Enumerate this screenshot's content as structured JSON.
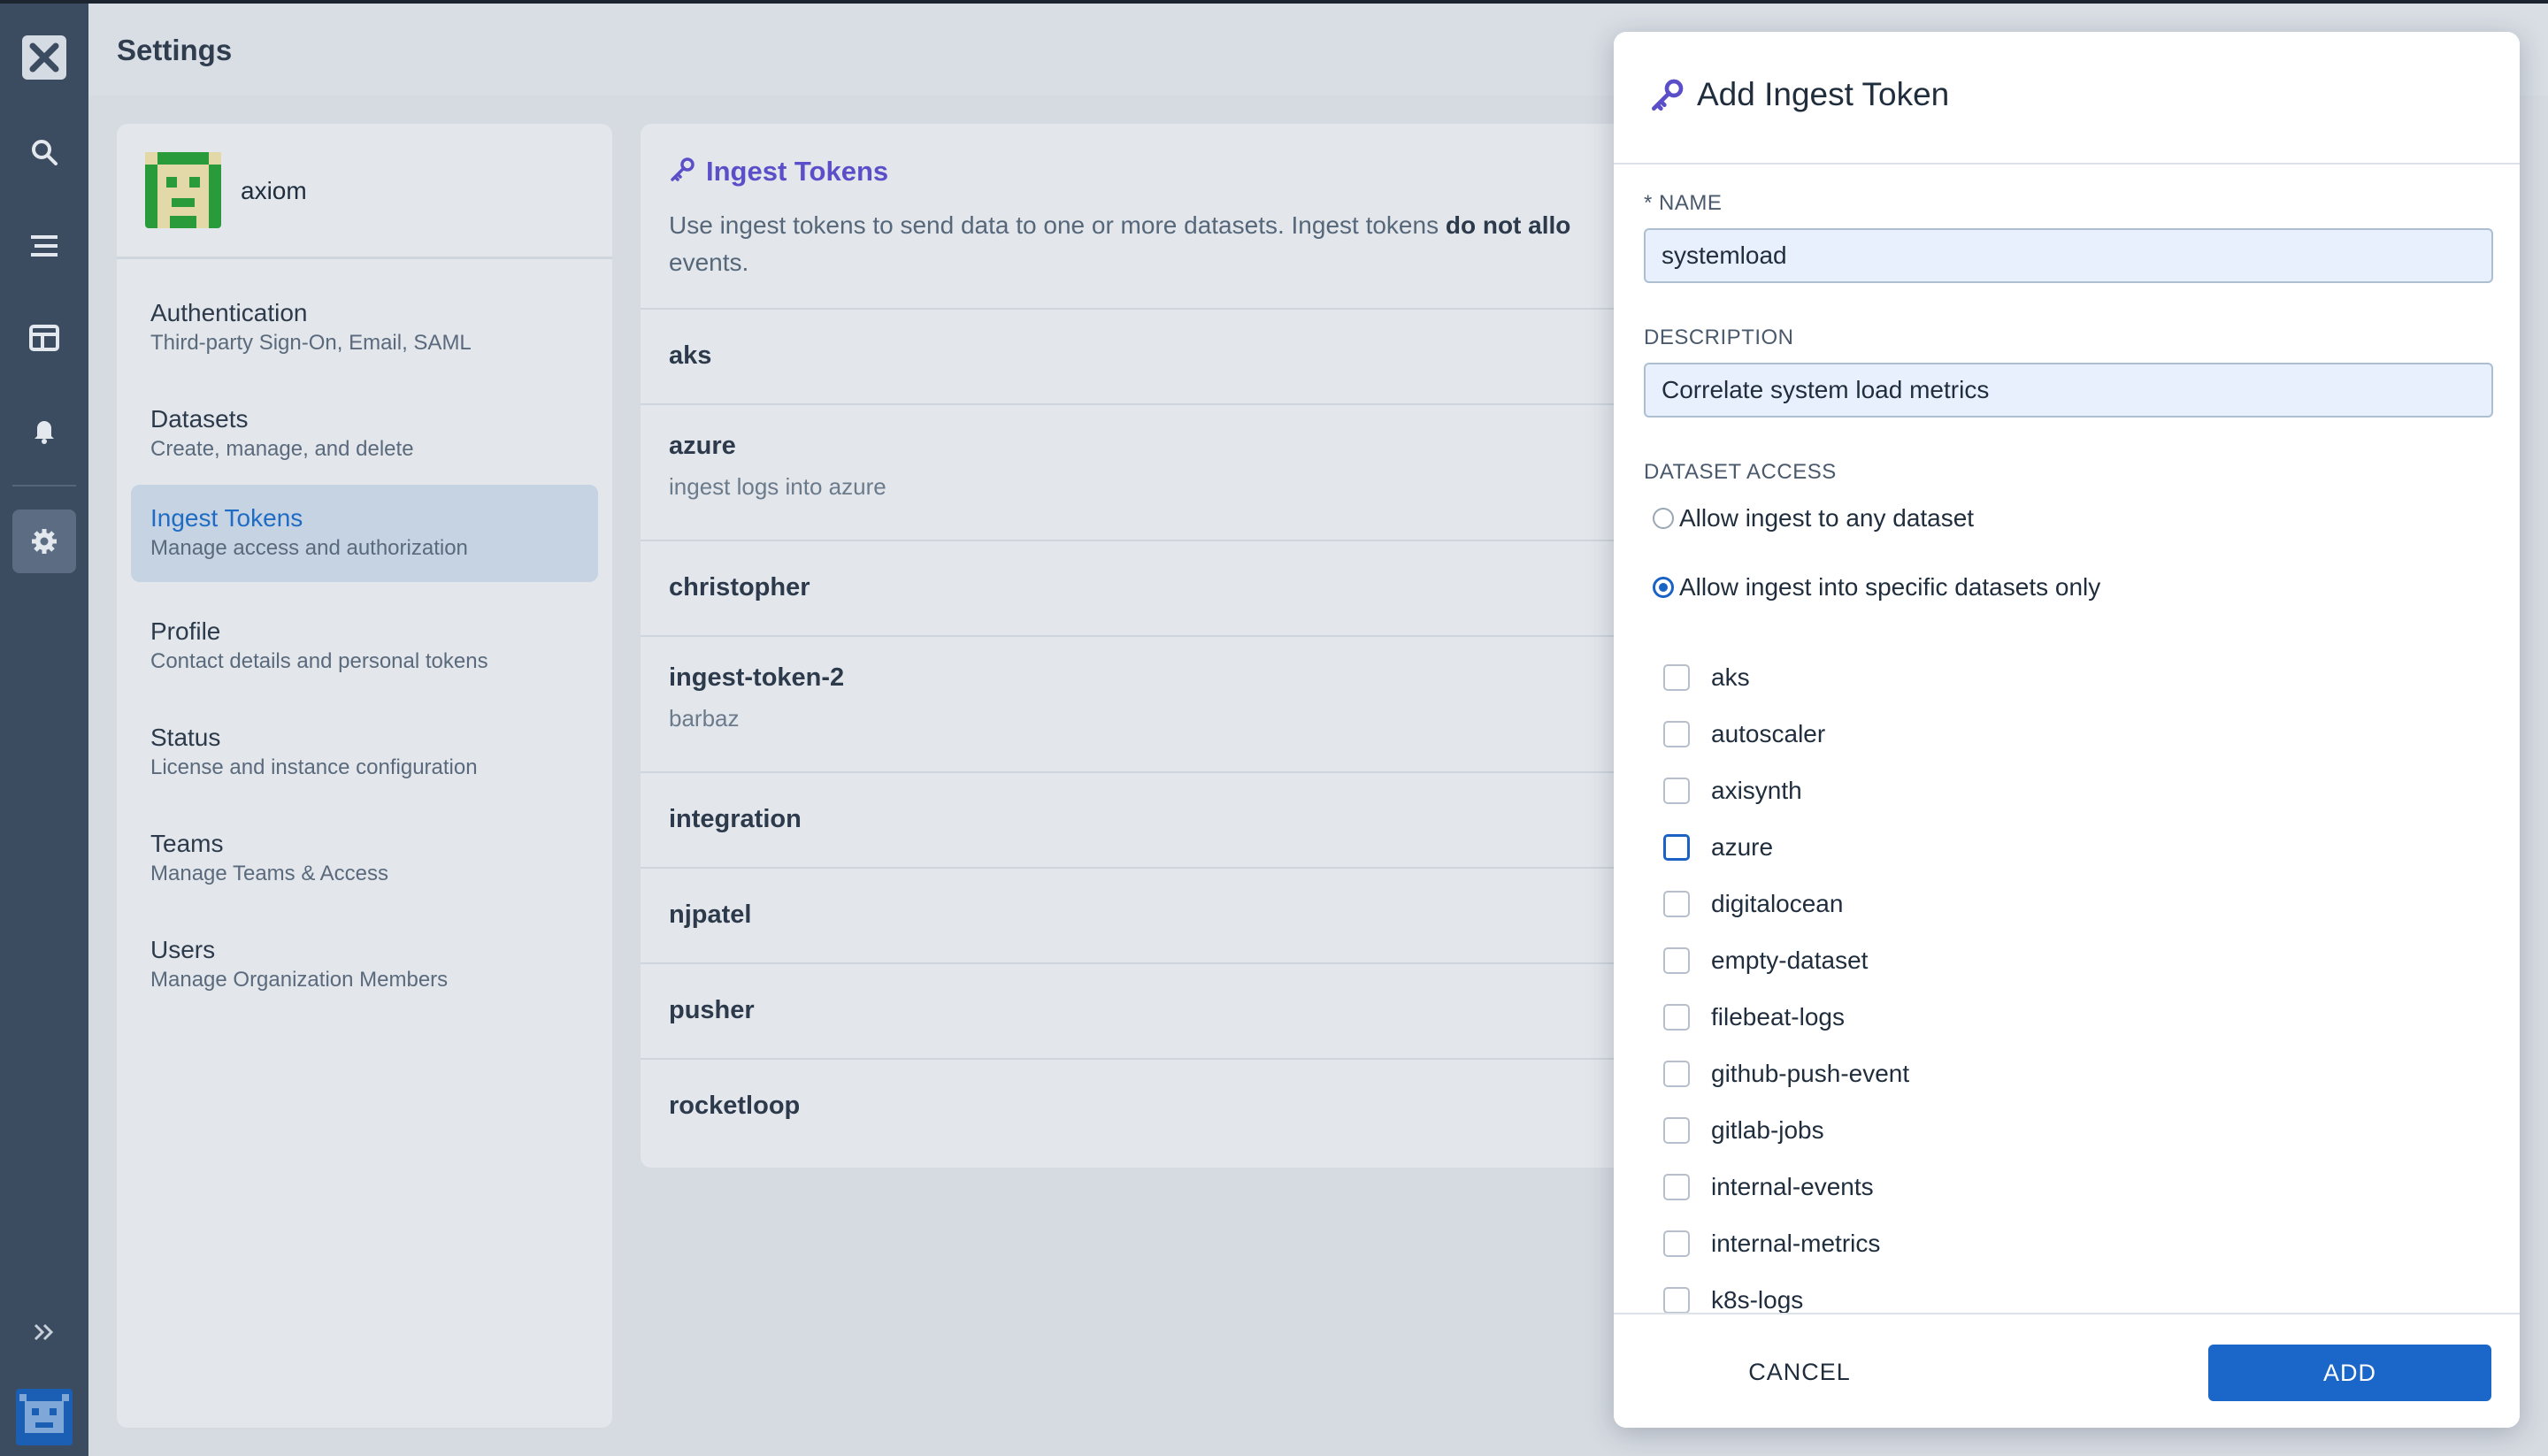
{
  "header": {
    "title": "Settings"
  },
  "rail": {
    "icons": [
      "axiom-logo-icon",
      "search-icon",
      "stream-icon",
      "dashboard-icon",
      "bell-icon",
      "gear-icon",
      "expand-icon"
    ]
  },
  "org": {
    "name": "axiom"
  },
  "nav": {
    "items": [
      {
        "title": "Authentication",
        "sub": "Third-party Sign-On, Email, SAML"
      },
      {
        "title": "Datasets",
        "sub": "Create, manage, and delete"
      },
      {
        "title": "Ingest Tokens",
        "sub": "Manage access and authorization"
      },
      {
        "title": "Profile",
        "sub": "Contact details and personal tokens"
      },
      {
        "title": "Status",
        "sub": "License and instance configuration"
      },
      {
        "title": "Teams",
        "sub": "Manage Teams & Access"
      },
      {
        "title": "Users",
        "sub": "Manage Organization Members"
      }
    ]
  },
  "tokens": {
    "title": "Ingest Tokens",
    "intro_pre": "Use ingest tokens to send data to one or more datasets. Ingest tokens ",
    "intro_bold": "do not allo",
    "intro_line2": "events.",
    "rows": [
      {
        "name": "aks",
        "desc": ""
      },
      {
        "name": "azure",
        "desc": "ingest logs into azure"
      },
      {
        "name": "christopher",
        "desc": ""
      },
      {
        "name": "ingest-token-2",
        "desc": "barbaz"
      },
      {
        "name": "integration",
        "desc": ""
      },
      {
        "name": "njpatel",
        "desc": ""
      },
      {
        "name": "pusher",
        "desc": ""
      },
      {
        "name": "rocketloop",
        "desc": ""
      }
    ]
  },
  "modal": {
    "title": "Add Ingest Token",
    "name_label": "* NAME",
    "name_value": "systemload",
    "desc_label": "DESCRIPTION",
    "desc_value": "Correlate system load metrics",
    "access_label": "DATASET ACCESS",
    "radio_any": "Allow ingest to any dataset",
    "radio_specific": "Allow ingest into specific datasets only",
    "selected_radio": "specific",
    "datasets": [
      "aks",
      "autoscaler",
      "axisynth",
      "azure",
      "digitalocean",
      "empty-dataset",
      "filebeat-logs",
      "github-push-event",
      "gitlab-jobs",
      "internal-events",
      "internal-metrics",
      "k8s-logs"
    ],
    "cancel_label": "CANCEL",
    "add_label": "ADD"
  },
  "colors": {
    "accent": "#1a66c9",
    "rail": "#3b4b60",
    "link": "#5b4fc9"
  }
}
